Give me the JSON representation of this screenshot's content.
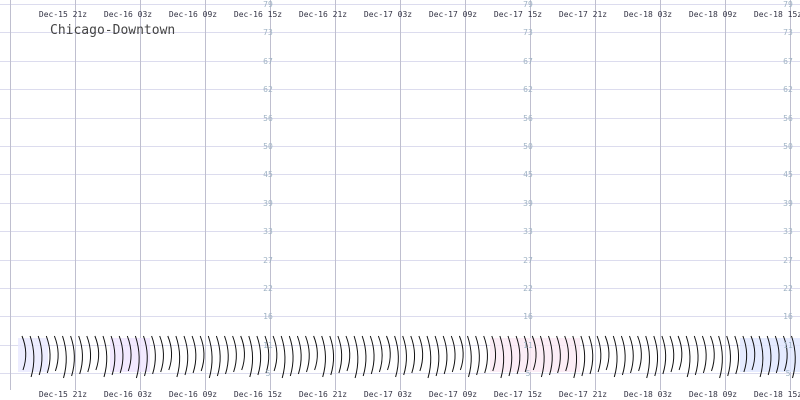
{
  "chart_data": {
    "type": "line",
    "title": "Chicago-Downtown",
    "x_ticks": [
      "Dec-15 21z",
      "Dec-16 03z",
      "Dec-16 09z",
      "Dec-16 15z",
      "Dec-16 21z",
      "Dec-17 03z",
      "Dec-17 09z",
      "Dec-17 15z",
      "Dec-17 21z",
      "Dec-18 03z",
      "Dec-18 09z",
      "Dec-18 15z"
    ],
    "x_ticks_bottom": [
      "Dec-15 21z",
      "Dec-16 03z",
      "Dec-16 09z",
      "Dec-16 15z",
      "Dec-16 21z",
      "Dec-17 03z",
      "Dec-17 09z",
      "Dec-17 15z",
      "Dec-17 21z",
      "Dec-18 03z",
      "Dec-18 09z",
      "Dec-18 15z"
    ],
    "y_ticks": [
      79,
      73,
      67,
      62,
      56,
      50,
      45,
      39,
      33,
      27,
      22,
      16,
      11,
      5
    ],
    "y_label_columns_at_ticks": [
      3,
      7,
      11
    ],
    "grid": true,
    "colors": {
      "grid_h": "#dcdcee",
      "grid_v": "#bfbfcf",
      "y_label": "#9fb3c4",
      "barb": "#111111"
    }
  }
}
